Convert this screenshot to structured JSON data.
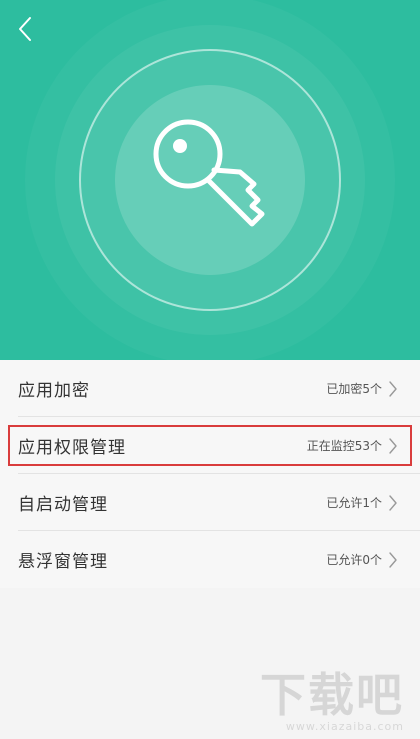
{
  "colors": {
    "accent": "#2dbd9f",
    "highlight": "#d93c3c",
    "text": "#333333"
  },
  "icons": {
    "back": "chevron-left-icon",
    "hero": "key-icon",
    "row_arrow": "chevron-right-icon"
  },
  "menu": {
    "items": [
      {
        "title": "应用加密",
        "status": "已加密5个"
      },
      {
        "title": "应用权限管理",
        "status": "正在监控53个"
      },
      {
        "title": "自启动管理",
        "status": "已允许1个"
      },
      {
        "title": "悬浮窗管理",
        "status": "已允许0个"
      }
    ]
  },
  "watermark": {
    "logo": "下载吧",
    "url": "www.xiazaiba.com"
  }
}
